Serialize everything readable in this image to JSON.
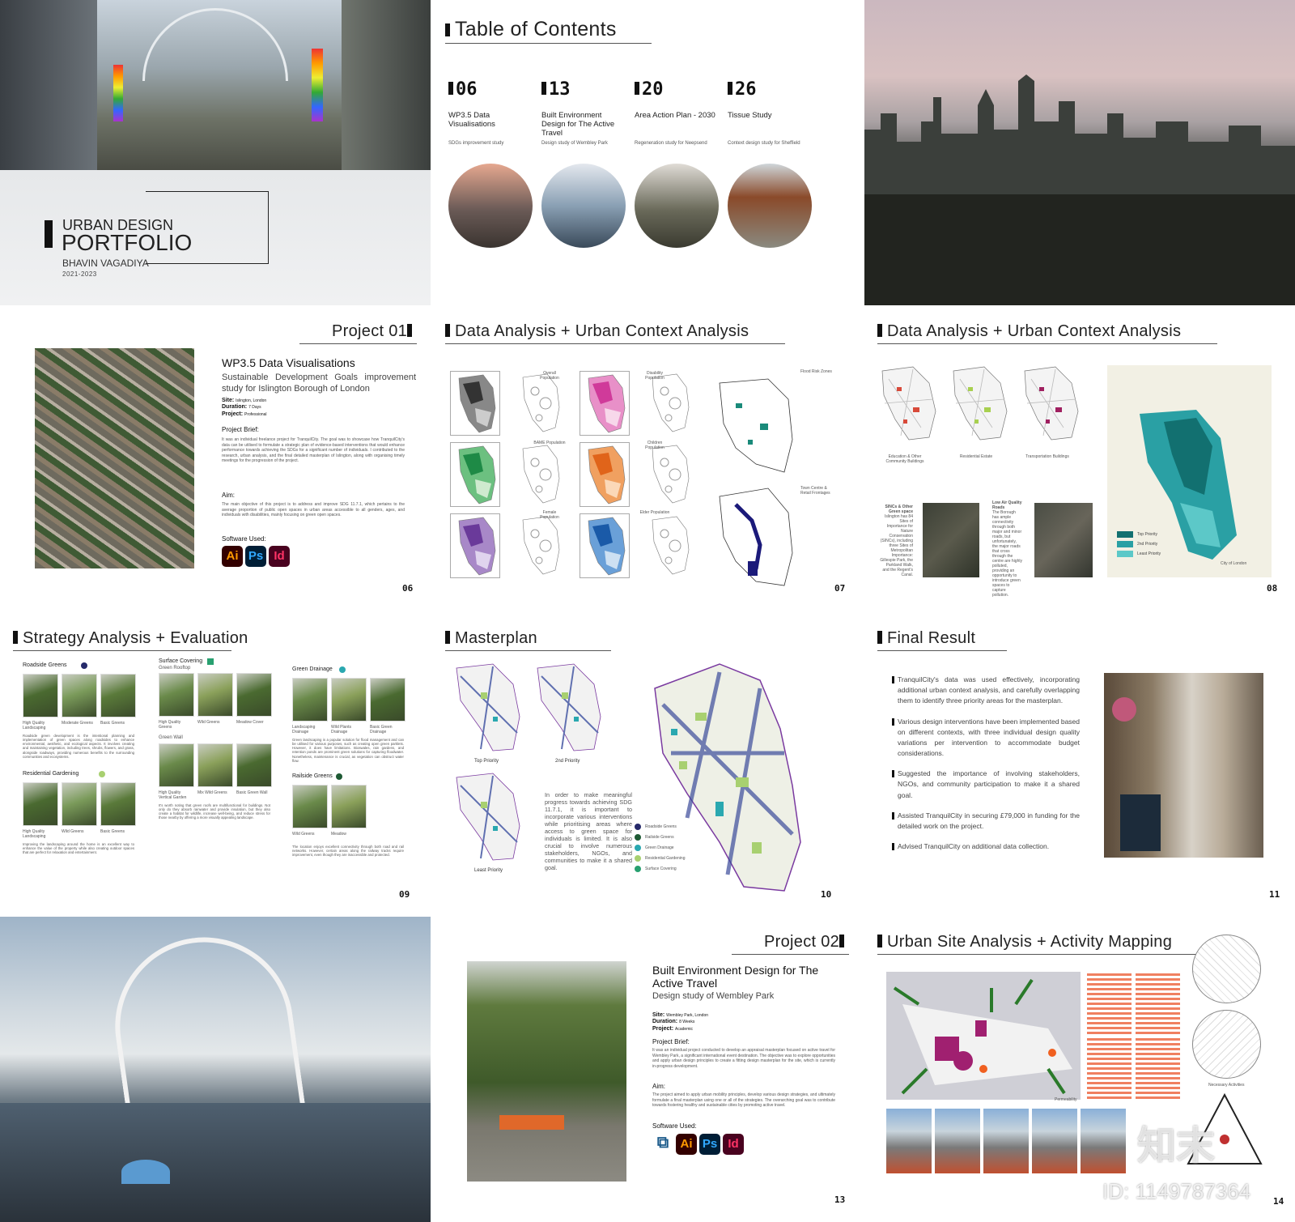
{
  "cover": {
    "line1": "URBAN DESIGN",
    "line2": "PORTFOLIO",
    "author": "BHAVIN VAGADIYA",
    "years": "2021-2023"
  },
  "toc": {
    "title": "Table  of  Contents",
    "items": [
      {
        "num": "06",
        "title": "WP3.5 Data Visualisations",
        "sub": "SDGs improvement study"
      },
      {
        "num": "13",
        "title": "Built Environment Design for The Active Travel",
        "sub": "Design study of Wembley Park"
      },
      {
        "num": "20",
        "title": "Area Action Plan - 2030",
        "sub": "Regeneration study for Neepsend"
      },
      {
        "num": "26",
        "title": "Tissue Study",
        "sub": "Context design study for Sheffield"
      }
    ]
  },
  "project01": {
    "heading": "Project  01",
    "title": "WP3.5 Data Visualisations",
    "subtitle": "Sustainable Development Goals improvement study for Islington Borough of London",
    "site_label": "Site:",
    "site": "Islington, London",
    "duration_label": "Duration:",
    "duration": "7 Days",
    "project_label": "Project:",
    "project": "Professional",
    "brief_label": "Project Brief:",
    "brief": "It was an individual freelance project for TranquilCity. The goal was to showcase how TranquilCity's data can be utilised to formulate a strategic plan of evidence-based interventions that would enhance performance towards achieving the SDGs for a significant number of individuals. I contributed to the research, urban analysis, and the final detailed masterplan of Islington, along with organising timely meetings for the progression of the project.",
    "aim_label": "Aim:",
    "aim": "The main objective of this project is to address and improve SDG 11.7.1, which pertains to the average proportion of public open spaces in urban areas accessible to all genders, ages, and individuals with disabilities, mainly focusing on green open spaces.",
    "software_label": "Software Used:",
    "software": [
      "Ai",
      "Ps",
      "Id"
    ],
    "page": "06"
  },
  "data1": {
    "heading": "Data  Analysis  +  Urban  Context  Analysis",
    "labels": [
      "Overall Population",
      "BAME Population",
      "Female Population",
      "Disability Population",
      "Children Population",
      "Elder Population"
    ],
    "flood": "Flood Risk Zones",
    "town": "Town Centre & Retail Frontages",
    "page": "07"
  },
  "data2": {
    "heading": "Data  Analysis  +  Urban  Context  Analysis",
    "labels": [
      "Education & Other Community Buildings",
      "Residential Estate",
      "Transportation Buildings"
    ],
    "sincs_title": "SINCs & Other Green space",
    "sincs": "Islington has 84 Sites of Importance for Nature Conservation (SINCs), including three Sites of Metropolitan Importance: Gillespie Park, the Parkland Walk, and the Regent's Canal.",
    "air_title": "Low Air Quality Roads",
    "air": "The Borough has ample connectivity through both major and minor roads, but unfortunately, the major roads that cross through the centre are highly polluted, providing an opportunity to introduce green spaces to capture pollution.",
    "legend": [
      "Top Priority",
      "2nd Priority",
      "Least Priority"
    ],
    "city": "City of London",
    "page": "08"
  },
  "strategy": {
    "heading": "Strategy Analysis + Evaluation",
    "roadside": {
      "title": "Roadside Greens",
      "caps": [
        "High Quality Landscaping",
        "Moderate Greens",
        "Basic Greens"
      ],
      "text": "Roadside green development is the intentional planning and implementation of green spaces along roadsides to enhance environmental, aesthetic, and ecological aspects. It involves creating and maintaining vegetation, including trees, shrubs, flowers, and grass, alongside roadways, providing numerous benefits to the surrounding communities and ecosystems."
    },
    "residential": {
      "title": "Residential Gardening",
      "caps": [
        "High Quality Landscaping",
        "Wild Greens",
        "Basic Greens"
      ],
      "text": "Improving the landscaping around the home is an excellent way to enhance the value of the property while also creating outdoor spaces that are perfect for relaxation and entertainment."
    },
    "surface": {
      "title": "Surface Covering",
      "rooftop": "Green Rooftop",
      "caps": [
        "High Quality Greens",
        "Wild Greens",
        "Meadow Cover"
      ],
      "wall": "Green Wall",
      "wallcaps": [
        "High Quality Vertical Garden",
        "Mix Wild Greens",
        "Basic Green Wall"
      ],
      "text": "It's worth noting that green roofs are multifunctional for buildings. Not only do they absorb rainwater and provide insulation, but they also create a habitat for wildlife, increase well-being, and reduce stress for those nearby by offering a more visually appealing landscape."
    },
    "drainage": {
      "title": "Green Drainage",
      "caps": [
        "Landscaping Drainage",
        "Wild Plants Drainage",
        "Basic Green Drainage"
      ],
      "text": "Green landscaping is a popular solution for flood management and can be utilised for various purposes, such as creating open green parklets. However, it does have limitations. Bioswales, rain gardens, and retention ponds are prominent green solutions for capturing floodwater. Nonetheless, maintenance is crucial, as vegetation can obstruct water flow."
    },
    "railside": {
      "title": "Railside Greens",
      "caps": [
        "Wild Greens",
        "Meadow"
      ],
      "text": "The location enjoys excellent connectivity through both road and rail networks. However, certain areas along the railway tracks require improvement, even though they are inaccessible and protected."
    },
    "page": "09"
  },
  "masterplan": {
    "heading": "Masterplan",
    "maps": [
      "Top Priority",
      "2nd Priority",
      "Least Priority"
    ],
    "text": "In order to make meaningful progress towards achieving SDG 11.7.1, it is important to incorporate various interventions while prioritising areas where access to green space for individuals is limited. It is also crucial to involve numerous stakeholders, NGOs, and communities to make it a shared goal.",
    "legend": [
      {
        "label": "Roadside Greens",
        "color": "#262a6a"
      },
      {
        "label": "Railside Greens",
        "color": "#1e5a34"
      },
      {
        "label": "Green Drainage",
        "color": "#2aa8b0"
      },
      {
        "label": "Residential Gardening",
        "color": "#a8d070"
      },
      {
        "label": "Surface Covering",
        "color": "#28a070"
      }
    ],
    "page": "10"
  },
  "final": {
    "heading": "Final Result",
    "bullets": [
      "TranquilCity's data was used effectively, incorporating additional urban context analysis, and carefully overlapping them to identify three priority areas for the masterplan.",
      "Various design interventions have been implemented based on different contexts, with three individual design quality variations per intervention to accommodate budget considerations.",
      "Suggested the importance of involving stakeholders, NGOs, and community participation to make it a shared goal.",
      "Assisted TranquilCity in securing £79,000 in funding for the detailed work on the project.",
      "Advised TranquilCity on additional data collection."
    ],
    "page": "11"
  },
  "project02": {
    "heading": "Project  02",
    "title": "Built Environment Design for The Active Travel",
    "subtitle": "Design study of Wembley Park",
    "site_label": "Site:",
    "site": "Wembley Park, London",
    "duration_label": "Duration:",
    "duration": "8 Weeks",
    "project_label": "Project:",
    "project": "Academic",
    "brief_label": "Project Brief:",
    "brief": "It was an individual project conducted to develop an appraisal masterplan focused on active travel for Wembley Park, a significant international event destination. The objective was to explore opportunities and apply urban design principles to create a fitting design masterplan for the site, which is currently in-progress development.",
    "aim_label": "Aim:",
    "aim": "The project aimed to apply urban mobility principles, develop various design strategies, and ultimately formulate a final masterplan using one or all of the strategies. The overarching goal was to contribute towards fostering healthy and sustainable cities by promoting active travel.",
    "software_label": "Software Used:",
    "software": [
      "Ai",
      "Ps",
      "Id"
    ],
    "page": "13"
  },
  "site": {
    "heading": "Urban Site Analysis + Activity Mapping",
    "permeability": "Permeability",
    "activities": "Necessary Activities",
    "page": "14"
  },
  "watermark": {
    "logo": "知末",
    "id": "ID: 1149787364"
  },
  "colors": {
    "ai": "#ff9a00",
    "ai_bg": "#330000",
    "ps": "#31a8ff",
    "ps_bg": "#001e36",
    "id": "#ff3366",
    "id_bg": "#49021f"
  }
}
